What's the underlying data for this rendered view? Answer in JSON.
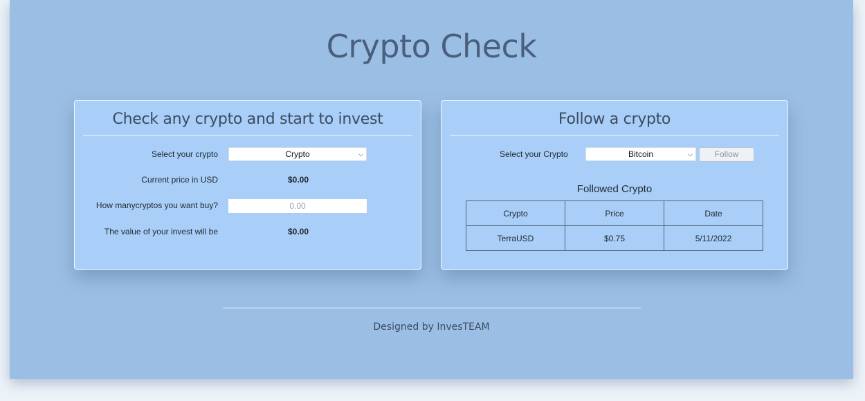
{
  "app": {
    "title": "Crypto Check"
  },
  "invest_card": {
    "title": "Check any crypto and start to invest",
    "select_label": "Select your crypto",
    "select_value": "Crypto",
    "price_label": "Current price in USD",
    "price_value": "$0.00",
    "amount_label": "How manycryptos you want buy?",
    "amount_placeholder": "0.00",
    "invest_label": "The value of your invest will be",
    "invest_value": "$0.00"
  },
  "follow_card": {
    "title": "Follow a crypto",
    "select_label": "Select your Crypto",
    "select_value": "Bitcoin",
    "follow_button": "Follow",
    "followed_title": "Followed Crypto",
    "table": {
      "headers": [
        "Crypto",
        "Price",
        "Date"
      ],
      "rows": [
        [
          "TerraUSD",
          "$0.75",
          "5/11/2022"
        ]
      ]
    }
  },
  "footer": {
    "text": "Designed by InvesTEAM"
  },
  "colors": {
    "background": "#9bbfe4",
    "card": "#a9cff8",
    "title": "#4a5f7e"
  },
  "icons": {
    "select_chevron": "chevron-down-icon"
  }
}
